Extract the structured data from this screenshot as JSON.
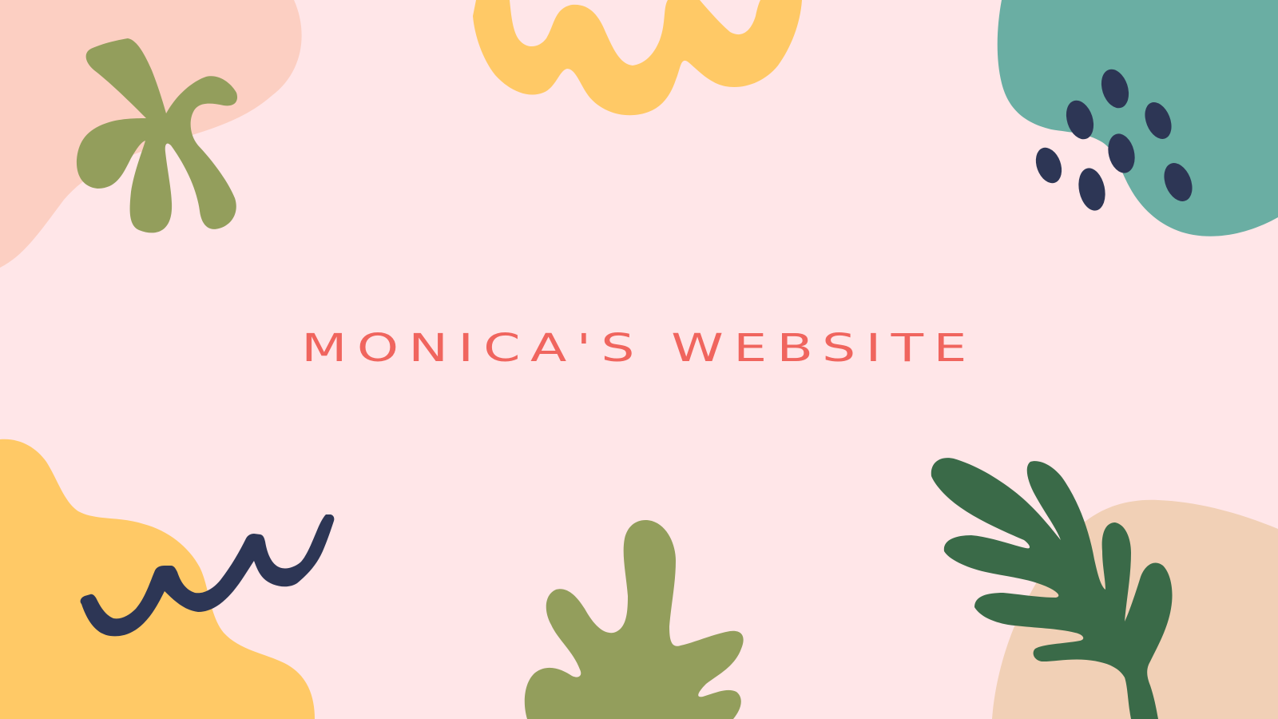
{
  "page": {
    "title": "MONICA'S WEBSITE"
  },
  "colors": {
    "background": "#FFE6E8",
    "title": "#F0655E",
    "peach_blob": "#FCCFC2",
    "yellow": "#FFC966",
    "teal": "#6AAEA3",
    "navy": "#2D3655",
    "olive": "#939E5C",
    "dark_green": "#3A6A48",
    "tan_blob": "#F1D0B6"
  },
  "decorations": [
    "peach-blob",
    "olive-starfish-plant",
    "yellow-squiggle",
    "teal-blob",
    "navy-dots",
    "yellow-blob",
    "navy-squiggle",
    "olive-coral-plant",
    "tan-blob",
    "dark-green-leaf"
  ]
}
